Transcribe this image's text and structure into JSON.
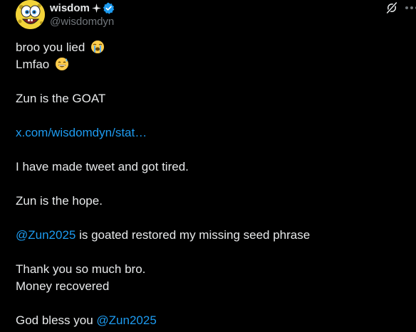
{
  "author": {
    "display_name": "wisdom",
    "handle": "@wisdomdyn"
  },
  "icons": {
    "sparkle": "sparkle-icon",
    "verified": "verified-badge-icon",
    "grok": "grok-icon",
    "more": "more-icon",
    "crying_emoji": "loudly-crying-face-emoji",
    "sweat_smile_emoji": "grinning-face-with-sweat-emoji"
  },
  "colors": {
    "background": "#000000",
    "text": "#e7e9ea",
    "secondary_text": "#71767b",
    "link": "#1d9bf0",
    "verified": "#1d9bf0"
  },
  "tweet": {
    "line1": "broo you lied",
    "line2": "Lmfao",
    "line3": "Zun is the GOAT",
    "link": "x.com/wisdomdyn/stat…",
    "line5": "I have made tweet and got tired.",
    "line6": "Zun is the hope.",
    "mention1": "@Zun2025",
    "line7_rest": " is goated restored my missing seed phrase",
    "line8": "Thank you so much bro.",
    "line9": "Money recovered",
    "line10_prefix": "God bless you ",
    "mention2": "@Zun2025"
  }
}
